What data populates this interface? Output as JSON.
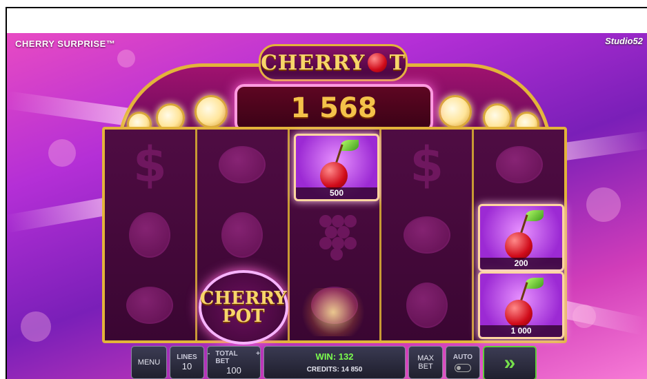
{
  "brand": {
    "game_title": "CHERRY SURPRISE™",
    "studio": "Studio52"
  },
  "marquee": {
    "logo_word1": "CHERRY",
    "logo_word2": "T",
    "win_amount": "1 568"
  },
  "reels": {
    "reel1": [
      "dollar",
      "plum",
      "lemon"
    ],
    "reel2": [
      "lemon",
      "plum",
      "cherry-pot"
    ],
    "reel3": [
      "cherry",
      "grape",
      "lemon"
    ],
    "reel4": [
      "dollar",
      "lemon",
      "plum"
    ],
    "reel5": [
      "lemon",
      "cherry",
      "cherry"
    ],
    "cherry_values": {
      "reel3_top": "500",
      "reel5_mid": "200",
      "reel5_bottom": "1 000"
    },
    "pot_symbol": {
      "line1": "CHERRY",
      "line2": "POT"
    }
  },
  "controls": {
    "menu_label": "MENU",
    "lines_label": "LINES",
    "lines_value": "10",
    "total_bet_label": "TOTAL BET",
    "total_bet_minus": "-",
    "total_bet_plus": "+",
    "total_bet_value": "100",
    "win_text": "WIN: 132",
    "credits_text": "CREDITS: 14 850",
    "max_bet_line1": "MAX",
    "max_bet_line2": "BET",
    "auto_label": "AUTO",
    "spin_glyph": "»"
  },
  "colors": {
    "gold": "#e3b43a",
    "win_green": "#7cff4f",
    "spin_green": "#76e04c",
    "win_digits": "#f4c24a"
  }
}
